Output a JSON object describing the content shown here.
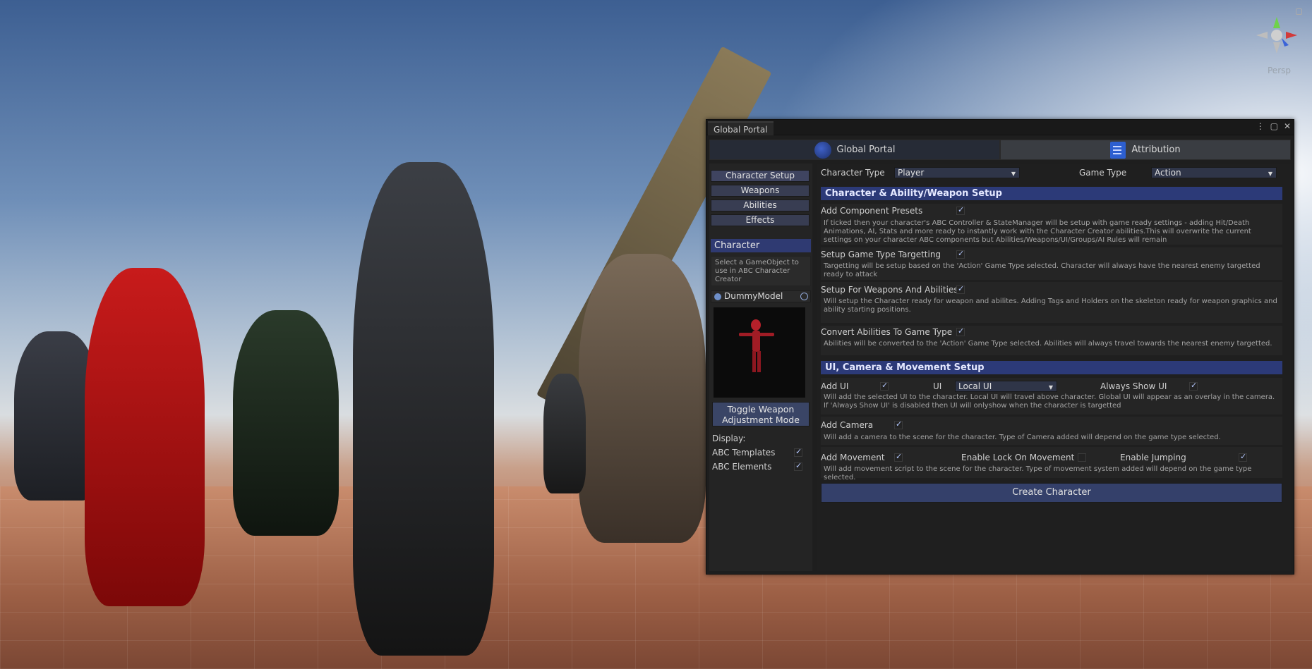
{
  "viewport": {
    "persp_label": "Persp",
    "gizmo_icon": "scene-orientation-gizmo"
  },
  "window": {
    "tab_title": "Global Portal",
    "controls": [
      "⋮",
      "▢",
      "✕"
    ],
    "top_tabs": [
      {
        "label": "Global Portal",
        "icon": "globe-icon"
      },
      {
        "label": "Attribution",
        "icon": "document-icon"
      }
    ]
  },
  "left": {
    "nav": [
      "Character Setup",
      "Weapons",
      "Abilities",
      "Effects"
    ],
    "section_title": "Character",
    "help": "Select a GameObject to use in ABC Character Creator",
    "object_field": "DummyModel",
    "toggle_button_line1": "Toggle Weapon",
    "toggle_button_line2": "Adjustment Mode",
    "display_label": "Display:",
    "display_options": [
      {
        "label": "ABC Templates",
        "checked": true
      },
      {
        "label": "ABC Elements",
        "checked": true
      }
    ]
  },
  "right": {
    "character_type_label": "Character Type",
    "character_type_value": "Player",
    "game_type_label": "Game Type",
    "game_type_value": "Action",
    "section1": "Character & Ability/Weapon Setup",
    "opt1_label": "Add Component Presets",
    "opt1_desc": "If ticked then your character's ABC Controller & StateManager will be setup with game ready settings - adding Hit/Death Animations, AI, Stats and more ready to instantly work with the Character Creator abilities.This will overwrite the current settings on your character ABC components but Abilities/Weapons/UI/Groups/AI Rules will remain",
    "opt2_label": "Setup Game Type Targetting",
    "opt2_desc": "Targetting will be setup based on the 'Action' Game Type selected. Character will always have the nearest enemy targetted ready to attack",
    "opt3_label": "Setup For Weapons And Abilities",
    "opt3_desc": "Will setup the Character ready for weapon and abilites. Adding Tags and Holders on the skeleton ready for weapon graphics and ability starting positions.",
    "opt4_label": "Convert Abilities To Game Type",
    "opt4_desc": "Abilities will be converted to the 'Action' Game Type selected. Abilities will always travel towards the nearest enemy targetted.",
    "section2": "UI, Camera & Movement Setup",
    "ui_label": "Add UI",
    "ui_type_label": "UI",
    "ui_type_value": "Local UI",
    "always_show_label": "Always Show UI",
    "ui_desc": "Will add the selected UI to the character. Local UI will travel above character. Global UI will appear as an overlay in the camera. If 'Always Show UI' is disabled then UI will onlyshow when the character is targetted",
    "camera_label": "Add Camera",
    "camera_desc": "Will add a camera to the scene for the character. Type of Camera added will depend on the game type selected.",
    "movement_label": "Add Movement",
    "lock_on_label": "Enable Lock On Movement",
    "jumping_label": "Enable Jumping",
    "movement_desc": "Will add movement script to the scene for the character. Type of movement system added will depend on the game type selected.",
    "create_button": "Create Character"
  }
}
